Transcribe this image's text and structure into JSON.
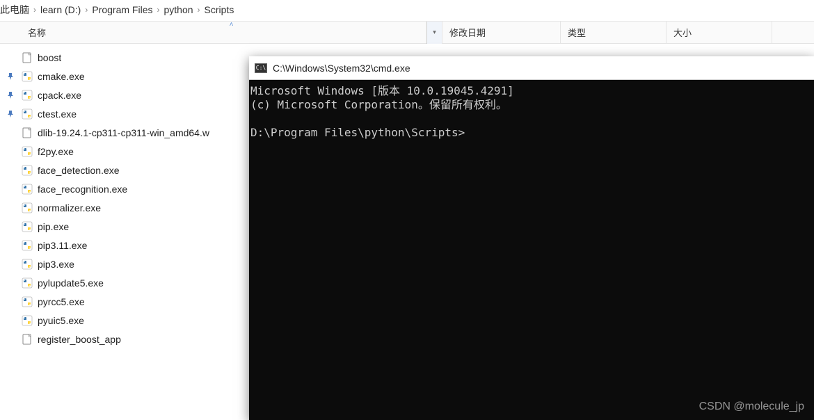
{
  "breadcrumb": {
    "items": [
      "此电脑",
      "learn (D:)",
      "Program Files",
      "python",
      "Scripts"
    ]
  },
  "columns": {
    "name": "名称",
    "date": "修改日期",
    "type": "类型",
    "size": "大小"
  },
  "files": [
    {
      "name": "boost",
      "icon": "file",
      "pinned": false
    },
    {
      "name": "cmake.exe",
      "icon": "pyexe",
      "pinned": true
    },
    {
      "name": "cpack.exe",
      "icon": "pyexe",
      "pinned": true
    },
    {
      "name": "ctest.exe",
      "icon": "pyexe",
      "pinned": true
    },
    {
      "name": "dlib-19.24.1-cp311-cp311-win_amd64.w",
      "icon": "file",
      "pinned": false
    },
    {
      "name": "f2py.exe",
      "icon": "pyexe",
      "pinned": false
    },
    {
      "name": "face_detection.exe",
      "icon": "pyexe",
      "pinned": false
    },
    {
      "name": "face_recognition.exe",
      "icon": "pyexe",
      "pinned": false
    },
    {
      "name": "normalizer.exe",
      "icon": "pyexe",
      "pinned": false
    },
    {
      "name": "pip.exe",
      "icon": "pyexe",
      "pinned": false
    },
    {
      "name": "pip3.11.exe",
      "icon": "pyexe",
      "pinned": false
    },
    {
      "name": "pip3.exe",
      "icon": "pyexe",
      "pinned": false
    },
    {
      "name": "pylupdate5.exe",
      "icon": "pyexe",
      "pinned": false
    },
    {
      "name": "pyrcc5.exe",
      "icon": "pyexe",
      "pinned": false
    },
    {
      "name": "pyuic5.exe",
      "icon": "pyexe",
      "pinned": false
    },
    {
      "name": "register_boost_app",
      "icon": "file",
      "pinned": false
    }
  ],
  "cmd": {
    "title": "C:\\Windows\\System32\\cmd.exe",
    "line1": "Microsoft Windows [版本 10.0.19045.4291]",
    "line2": "(c) Microsoft Corporation。保留所有权利。",
    "prompt": "D:\\Program Files\\python\\Scripts>"
  },
  "watermark": "CSDN @molecule_jp"
}
